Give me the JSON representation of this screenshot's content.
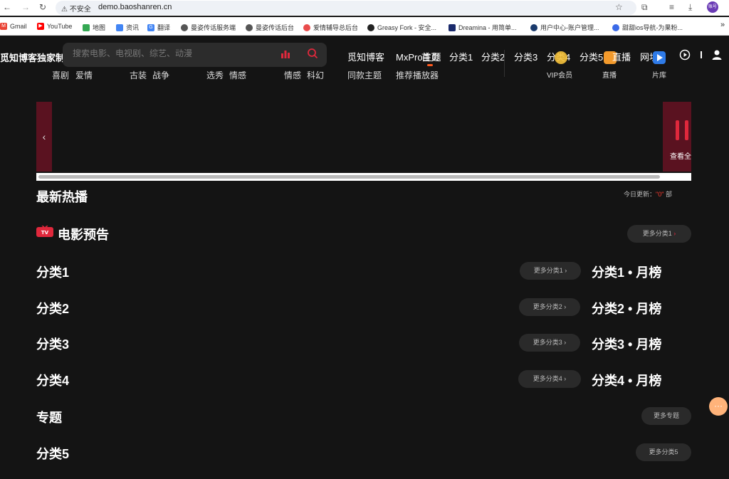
{
  "browser": {
    "insecure_label": "不安全",
    "url": "demo.baoshanren.cn",
    "profile_label": "账号"
  },
  "bookmarks": [
    {
      "label": "Gmail",
      "color": "#ea4335"
    },
    {
      "label": "YouTube",
      "color": "#ff0000"
    },
    {
      "label": "地图",
      "color": "#34a853"
    },
    {
      "label": "资讯",
      "color": "#4285f4"
    },
    {
      "label": "翻译",
      "color": "#4285f4"
    },
    {
      "label": "曼姿传话服务端",
      "color": "#555555"
    },
    {
      "label": "曼姿传话后台",
      "color": "#555555"
    },
    {
      "label": "爱情辅导总后台",
      "color": "#e94c4c"
    },
    {
      "label": "Greasy Fork - 安全...",
      "color": "#222222"
    },
    {
      "label": "Dreamina - 用简单...",
      "color": "#1a2a6c"
    },
    {
      "label": "用户中心-账户管理...",
      "color": "#1a3a6c"
    },
    {
      "label": "甜甜ios导航-为果粉...",
      "color": "#3b6ae8"
    }
  ],
  "header": {
    "logo": "觅知博客独家制作",
    "search_placeholder": "搜索电影、电视剧、综艺、动漫",
    "hotwords": [
      "喜剧",
      "爱情",
      "古装",
      "战争",
      "选秀",
      "情感",
      "情感",
      "科幻"
    ],
    "top_links": [
      "觅知博客",
      "MxPro主题"
    ],
    "sub_links": [
      "同款主题",
      "推荐播放器"
    ],
    "nav": [
      "首页",
      "分类1",
      "分类2",
      "分类3",
      "分类4",
      "分类5",
      "直播",
      "网址"
    ],
    "icon_labels": [
      "VIP会员",
      "直播",
      "片库"
    ]
  },
  "banner": {
    "view_all": "查看全"
  },
  "sections": {
    "latest": {
      "title": "最新热播",
      "today_prefix": "今日更新：",
      "today_count": "\"0\"",
      "today_suffix": "部"
    },
    "trailer": {
      "title": "电影预告",
      "more": "更多分类1"
    },
    "cats": [
      {
        "title": "分类1",
        "more": "更多分类1",
        "rank": "分类1 • 月榜"
      },
      {
        "title": "分类2",
        "more": "更多分类2",
        "rank": "分类2 • 月榜"
      },
      {
        "title": "分类3",
        "more": "更多分类3",
        "rank": "分类3 • 月榜"
      },
      {
        "title": "分类4",
        "more": "更多分类4",
        "rank": "分类4 • 月榜"
      }
    ],
    "topic": {
      "title": "专题",
      "more": "更多专题"
    },
    "cat5": {
      "title": "分类5",
      "more": "更多分类5"
    }
  },
  "float_button": "···"
}
